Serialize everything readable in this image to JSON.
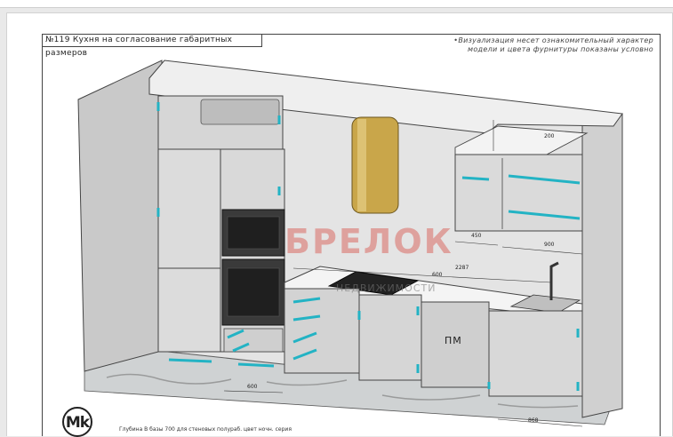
{
  "header": {
    "title": "№119 Кухня на согласование габаритных размеров",
    "note_line1": "•Визуализация несет ознакомительный характер",
    "note_line2": "модели и цвета фурнитуры показаны условно"
  },
  "watermark": {
    "brand": "БРЕЛОК",
    "sub": "НЕДВИЖИМОСТИ"
  },
  "drawing": {
    "module_label": "ПМ",
    "dims": {
      "d1": "200",
      "d2": "450",
      "d3": "900",
      "d4": "2287",
      "d5": "600",
      "d6": "600",
      "d7": "868"
    }
  },
  "footer": {
    "logo": "Mk",
    "text": "Глубина В базы 700 для стеновых полураб. цвет ночн. серия"
  },
  "colors": {
    "accent": "#23b3c4",
    "hood": "#c9a64a",
    "watermark": "#d6463c"
  }
}
